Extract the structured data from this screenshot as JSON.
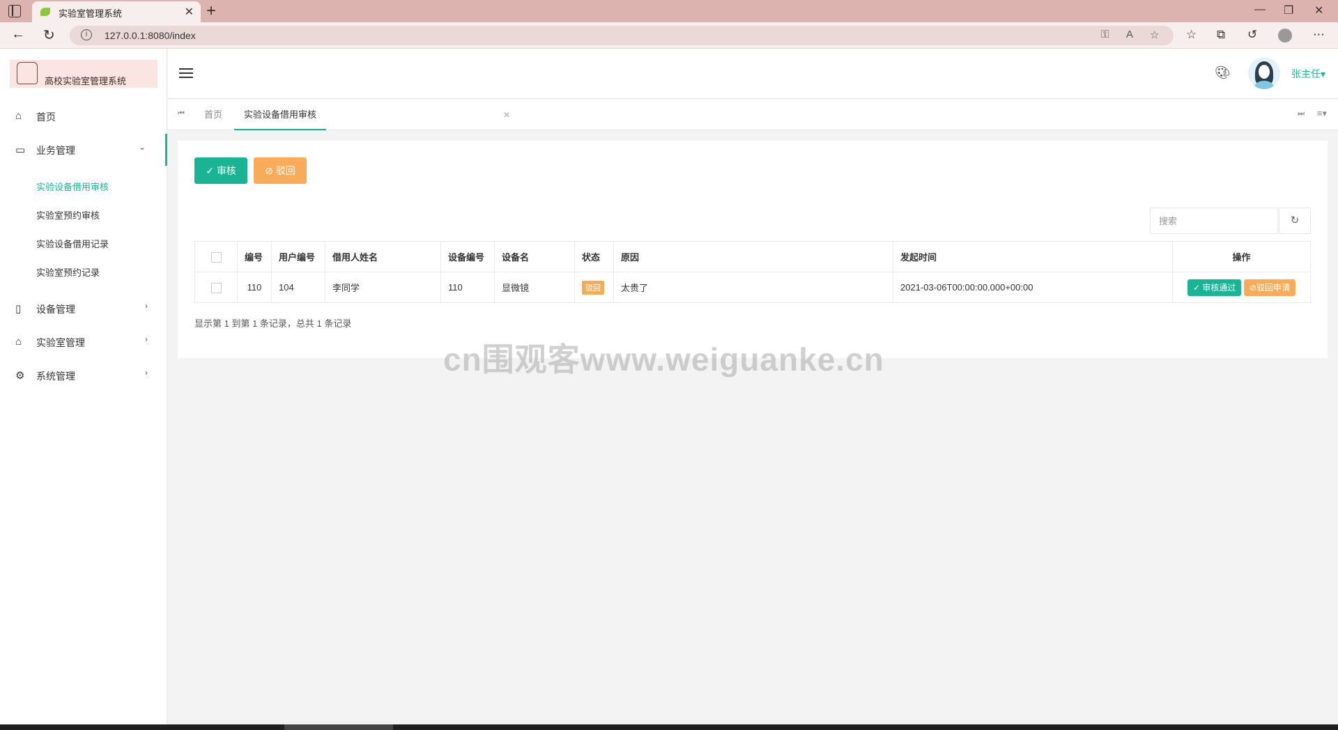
{
  "browser": {
    "tab_title": "实验室管理系统",
    "url": "127.0.0.1:8080/index"
  },
  "sidebar": {
    "logo_text": "高校实验室管理系统",
    "items": [
      {
        "label": "首页",
        "icon": "home-icon"
      },
      {
        "label": "业务管理",
        "icon": "laptop-icon",
        "expanded": true
      },
      {
        "label": "设备管理",
        "icon": "equipment-icon"
      },
      {
        "label": "实验室管理",
        "icon": "lab-icon"
      },
      {
        "label": "系统管理",
        "icon": "gear-icon"
      }
    ],
    "sub_items": [
      "实验设备借用审核",
      "实验室预约审核",
      "实验设备借用记录",
      "实验室预约记录"
    ]
  },
  "header": {
    "user_name": "张主任"
  },
  "content_tabs": [
    {
      "label": "首页",
      "active": false
    },
    {
      "label": "实验设备借用审核",
      "active": true
    }
  ],
  "toolbar": {
    "approve_label": "审核",
    "reject_label": "驳回"
  },
  "search": {
    "placeholder": "搜索"
  },
  "table": {
    "headers": [
      "编号",
      "用户编号",
      "借用人姓名",
      "设备编号",
      "设备名",
      "状态",
      "原因",
      "发起时间",
      "操作"
    ],
    "rows": [
      {
        "id": "110",
        "user_id": "104",
        "borrower": "李同学",
        "device_id": "110",
        "device_name": "显微镜",
        "status": "驳回",
        "reason": "太贵了",
        "time": "2021-03-06T00:00:00.000+00:00",
        "action_approve": "审核通过",
        "action_reject": "驳回申请"
      }
    ]
  },
  "pager_text": "显示第 1 到第 1 条记录，总共 1 条记录",
  "watermark": "cn围观客www.weiguanke.cn",
  "colors": {
    "primary": "#1ab394",
    "warning": "#f8ac59"
  }
}
